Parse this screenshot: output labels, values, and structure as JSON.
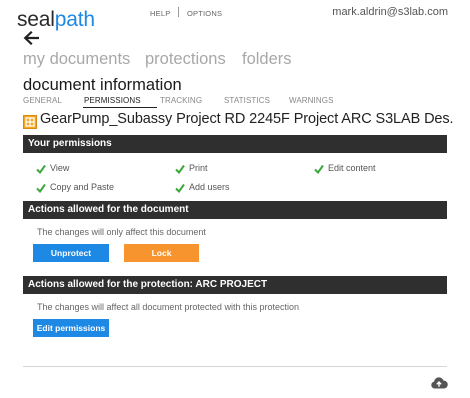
{
  "brand": {
    "part1": "seal",
    "part2": "path"
  },
  "top": {
    "help": "HELP",
    "options": "OPTIONS",
    "user_email": "mark.aldrin@s3lab.com"
  },
  "nav": [
    {
      "label": "my documents"
    },
    {
      "label": "protections"
    },
    {
      "label": "folders"
    }
  ],
  "page_title": "document information",
  "tabs": [
    {
      "label": "GENERAL"
    },
    {
      "label": "PERMISSIONS",
      "active": true
    },
    {
      "label": "TRACKING"
    },
    {
      "label": "STATISTICS"
    },
    {
      "label": "WARNINGS"
    }
  ],
  "document": {
    "name": "GearPump_Subassy Project RD 2245F Project ARC S3LAB Des."
  },
  "your_permissions": {
    "title": "Your permissions",
    "items": [
      "View",
      "Print",
      "Edit content",
      "Copy and Paste",
      "Add users"
    ]
  },
  "doc_actions": {
    "title": "Actions allowed for the document",
    "note": "The changes will only affect this document",
    "unprotect_label": "Unprotect",
    "lock_label": "Lock"
  },
  "protection_actions": {
    "title": "Actions allowed for the protection: ARC PROJECT",
    "note": "The changes will affect all document protected with this protection",
    "edit_label": "Edit permissions"
  },
  "colors": {
    "accent": "#1e88e5",
    "lock": "#f7942e",
    "section_bar": "#2f2f2f",
    "check": "#3aa83a",
    "file_icon": "#f5a623"
  },
  "icons": {
    "back": "arrow-left-icon",
    "check": "check-icon",
    "file": "protected-file-icon",
    "cloud": "cloud-upload-icon"
  }
}
